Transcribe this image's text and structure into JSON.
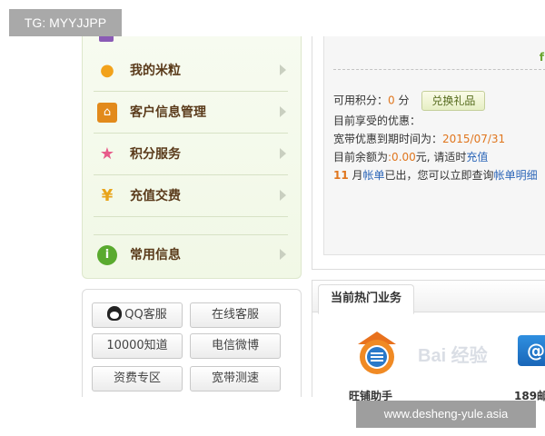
{
  "overlays": {
    "tag": "TG: MYYJJPP",
    "site": "www.desheng-yule.asia"
  },
  "menu": {
    "items": [
      {
        "label": "我的米粒",
        "icon": "rice-grain-icon"
      },
      {
        "label": "客户信息管理",
        "icon": "house-icon"
      },
      {
        "label": "积分服务",
        "icon": "star-icon"
      },
      {
        "label": "充值交费",
        "icon": "yen-icon"
      },
      {
        "label": "常用信息",
        "icon": "info-icon"
      }
    ]
  },
  "quick_services": {
    "buttons": [
      "QQ客服",
      "在线客服",
      "10000知道",
      "电信微博",
      "资费专区",
      "宽带测速"
    ]
  },
  "account": {
    "points_label": "可用积分：",
    "points_value": "0",
    "points_unit": " 分",
    "exchange_button": "兑换礼品",
    "discount_label": "目前享受的优惠：",
    "expiry_label": "宽带优惠到期时间为：",
    "expiry_date": "2015/07/31",
    "balance_label": "目前余额为",
    "balance_value": ":0.00",
    "balance_suffix": "元, 请适时",
    "recharge_link": "充值",
    "bill_month": "11",
    "bill_text_1": " 月",
    "bill_link": "帐单",
    "bill_text_2": "已出，您可以立即查询",
    "bill_detail_link": "帐单明细",
    "corner_mark": "f"
  },
  "hot_business": {
    "tab_label": "当前热门业务",
    "items": [
      {
        "name": "旺铺助手",
        "icon": "wang-shop-icon"
      },
      {
        "name": "189邮",
        "icon": "mail-189-icon"
      }
    ],
    "watermark": "Bai 经验"
  },
  "colors": {
    "menu_bg": "#f3f9ea",
    "accent_orange": "#e0761e",
    "link_blue": "#2c66b8"
  }
}
